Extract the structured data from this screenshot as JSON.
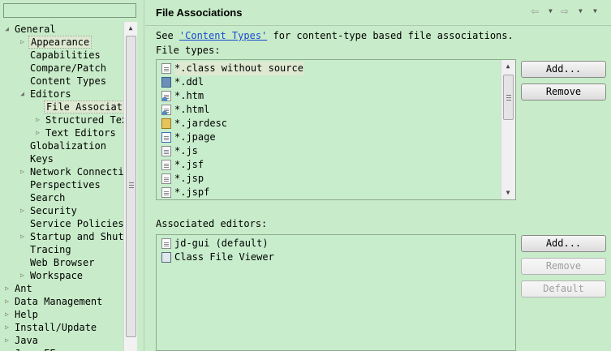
{
  "filter": {
    "value": ""
  },
  "tree": {
    "items": [
      {
        "label": "General",
        "depth": 0,
        "expander": "open"
      },
      {
        "label": "Appearance",
        "depth": 1,
        "expander": "closed",
        "selected": true
      },
      {
        "label": "Capabilities",
        "depth": 1,
        "expander": "none"
      },
      {
        "label": "Compare/Patch",
        "depth": 1,
        "expander": "none"
      },
      {
        "label": "Content Types",
        "depth": 1,
        "expander": "none"
      },
      {
        "label": "Editors",
        "depth": 1,
        "expander": "open"
      },
      {
        "label": "File Associations",
        "depth": 2,
        "expander": "none",
        "selected": true
      },
      {
        "label": "Structured Text Editors",
        "depth": 2,
        "expander": "closed"
      },
      {
        "label": "Text Editors",
        "depth": 2,
        "expander": "closed"
      },
      {
        "label": "Globalization",
        "depth": 1,
        "expander": "none"
      },
      {
        "label": "Keys",
        "depth": 1,
        "expander": "none"
      },
      {
        "label": "Network Connections",
        "depth": 1,
        "expander": "closed"
      },
      {
        "label": "Perspectives",
        "depth": 1,
        "expander": "none"
      },
      {
        "label": "Search",
        "depth": 1,
        "expander": "none"
      },
      {
        "label": "Security",
        "depth": 1,
        "expander": "closed"
      },
      {
        "label": "Service Policies",
        "depth": 1,
        "expander": "none"
      },
      {
        "label": "Startup and Shutdown",
        "depth": 1,
        "expander": "closed"
      },
      {
        "label": "Tracing",
        "depth": 1,
        "expander": "none"
      },
      {
        "label": "Web Browser",
        "depth": 1,
        "expander": "none"
      },
      {
        "label": "Workspace",
        "depth": 1,
        "expander": "closed"
      },
      {
        "label": "Ant",
        "depth": 0,
        "expander": "closed"
      },
      {
        "label": "Data Management",
        "depth": 0,
        "expander": "closed"
      },
      {
        "label": "Help",
        "depth": 0,
        "expander": "closed"
      },
      {
        "label": "Install/Update",
        "depth": 0,
        "expander": "closed"
      },
      {
        "label": "Java",
        "depth": 0,
        "expander": "closed"
      },
      {
        "label": "Java EE",
        "depth": 0,
        "expander": "closed"
      }
    ]
  },
  "page": {
    "title": "File Associations",
    "desc_prefix": "See ",
    "desc_link": "'Content Types'",
    "desc_suffix": " for content-type based file associations.",
    "file_types_label": "File types:",
    "associated_editors_label": "Associated editors:"
  },
  "nav": {
    "back_icon": "back-arrow-icon",
    "forward_icon": "forward-arrow-icon"
  },
  "file_types": [
    {
      "name": "*.class without source",
      "icon": "file-icon",
      "highlighted": true
    },
    {
      "name": "*.ddl",
      "icon": "ddl-icon"
    },
    {
      "name": "*.htm",
      "icon": "web-file-icon"
    },
    {
      "name": "*.html",
      "icon": "web-file-icon"
    },
    {
      "name": "*.jardesc",
      "icon": "jar-icon"
    },
    {
      "name": "*.jpage",
      "icon": "java-page-icon"
    },
    {
      "name": "*.js",
      "icon": "js-file-icon"
    },
    {
      "name": "*.jsf",
      "icon": "file-icon"
    },
    {
      "name": "*.jsp",
      "icon": "file-icon"
    },
    {
      "name": "*.jspf",
      "icon": "file-icon"
    }
  ],
  "associated_editors": [
    {
      "name": "jd-gui (default)",
      "icon": "file-icon"
    },
    {
      "name": "Class File Viewer",
      "icon": "class-viewer-icon"
    }
  ],
  "buttons": {
    "types_add": "Add...",
    "types_remove": "Remove",
    "editors_add": "Add...",
    "editors_remove": "Remove",
    "editors_default": "Default"
  },
  "colors": {
    "background": "#c8ecc9",
    "link": "#1a4ad1",
    "disabled_text": "#a0a0a0"
  }
}
